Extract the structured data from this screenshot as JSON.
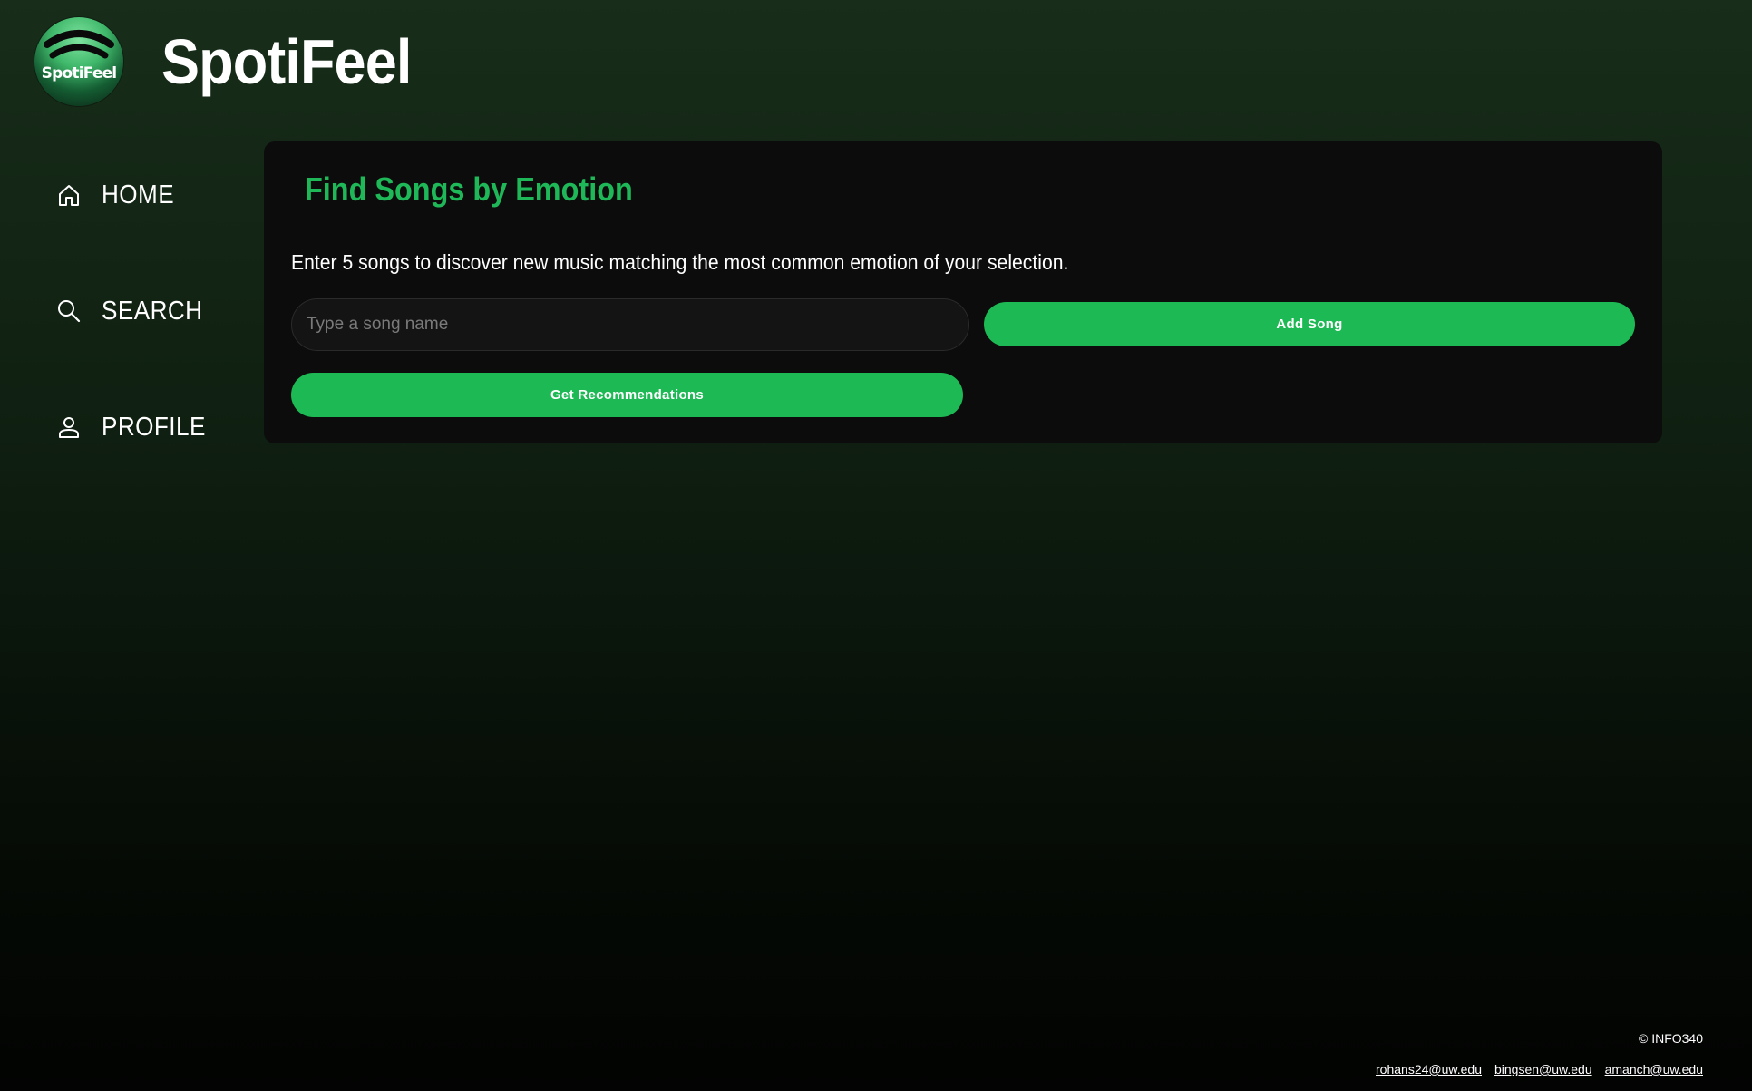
{
  "header": {
    "logo_text": "SpotiFeel",
    "app_title": "SpotiFeel"
  },
  "sidebar": {
    "items": [
      {
        "label": "HOME",
        "icon": "home-icon"
      },
      {
        "label": "SEARCH",
        "icon": "search-icon"
      },
      {
        "label": "PROFILE",
        "icon": "user-icon"
      }
    ]
  },
  "main": {
    "title": "Find Songs by Emotion",
    "description": "Enter 5 songs to discover new music matching the most common emotion of your selection.",
    "song_input": {
      "placeholder": "Type a song name",
      "value": ""
    },
    "add_song_label": "Add Song",
    "get_recommendations_label": "Get Recommendations"
  },
  "footer": {
    "copyright": "© INFO340",
    "emails": [
      "rohans24@uw.edu",
      "bingsen@uw.edu",
      "amanch@uw.edu"
    ]
  },
  "colors": {
    "accent": "#1db954",
    "title_green": "#1fb858",
    "card_bg": "#0c0c0c"
  }
}
